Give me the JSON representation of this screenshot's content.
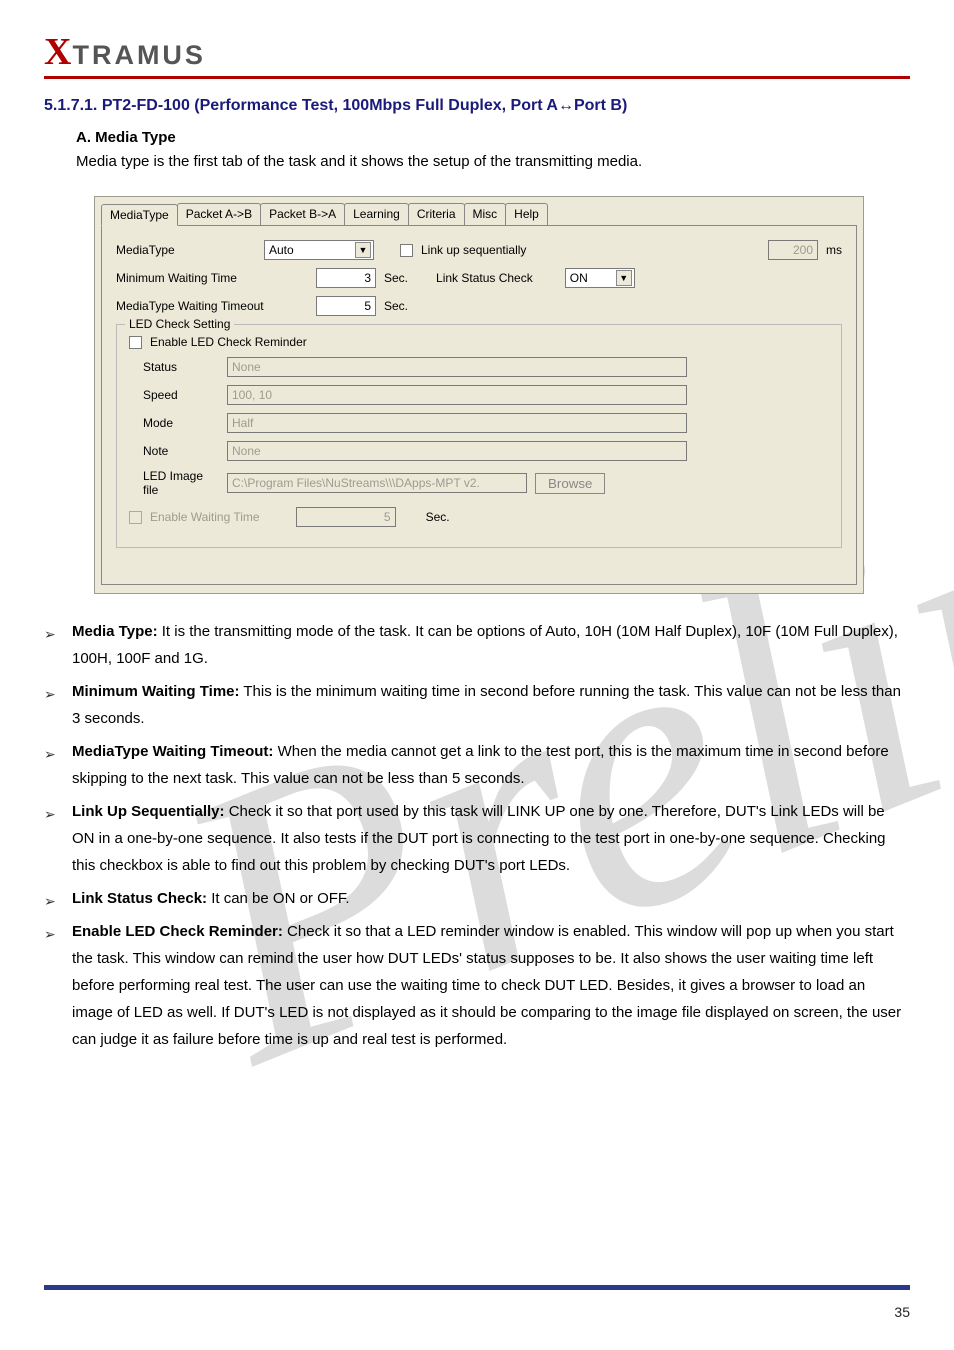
{
  "logo": {
    "x": "X",
    "text": "TRAMUS"
  },
  "heading": {
    "num": "5.1.7.1.",
    "title_prefix": "PT2-FD-100 (Performance Test, 100Mbps Full Duplex, Port A",
    "arrow": "↔",
    "title_suffix": "Port B)"
  },
  "subtitle": "A. Media Type",
  "desc": "Media type is the first tab of the task and it shows the setup of the transmitting media.",
  "tabs": [
    "MediaType",
    "Packet A->B",
    "Packet B->A",
    "Learning",
    "Criteria",
    "Misc",
    "Help"
  ],
  "form": {
    "mediaType_label": "MediaType",
    "mediaType_value": "Auto",
    "linkup_label": "Link up sequentially",
    "linkup_ms_value": "200",
    "ms": "ms",
    "minWait_label": "Minimum Waiting Time",
    "minWait_value": "3",
    "sec": "Sec.",
    "linkStatus_label": "Link Status Check",
    "linkStatus_value": "ON",
    "mtTimeout_label": "MediaType Waiting Timeout",
    "mtTimeout_value": "5",
    "led_group": "LED Check Setting",
    "enableLED_label": "Enable LED Check Reminder",
    "status_label": "Status",
    "status_value": "None",
    "speed_label": "Speed",
    "speed_value": "100, 10",
    "mode_label": "Mode",
    "mode_value": "Half",
    "note_label": "Note",
    "note_value": "None",
    "ledfile_label": "LED Image file",
    "ledfile_value": "C:\\Program Files\\NuStreams\\\\\\DApps-MPT v2.",
    "browse": "Browse",
    "enableWait_label": "Enable Waiting Time",
    "enableWait_value": "5"
  },
  "bullets": {
    "b1": {
      "label": "Media Type:",
      "text": " It is the transmitting mode of the task. It can be options of Auto, 10H (10M Half Duplex), 10F (10M Full Duplex), 100H, 100F and 1G."
    },
    "b2": {
      "label": "Minimum Waiting Time:",
      "text": " This is the minimum waiting time in second before running the task. This value can not be less than 3 seconds."
    },
    "b3": {
      "label": "MediaType Waiting Timeout:",
      "text": " When the media cannot get a link to the test port, this is the maximum time in second before skipping to the next task. This value can not be less than 5 seconds."
    },
    "b4": {
      "label": "Link Up Sequentially:",
      "text": " Check it so that port used by this task will LINK UP one by one. Therefore, DUT's Link LEDs will be ON in a one",
      "rest": "-by-one sequence. It also tests if the DUT port is connecting to the test port in one-by-one sequence. Checking this checkbox is able to find out this problem by checking DUT's port LEDs."
    },
    "b5": {
      "label": "Link Status Check:",
      "text": " It can be ON or OFF."
    },
    "b6": {
      "label": "Enable LED Check Reminder:",
      "text": " Check it so that a LED reminder window is enabled. This window will pop up when you start the task. This window can remind the user how DUT LEDs'",
      "rest2": "status supposes to be. It also shows the user waiting time left before performing real test. The user can use the waiting time to check DUT LED. Besides, it gives a browser to load an image of LED as well. If DUT's LED is not displayed as it should be comparing to the image file displayed on",
      "rest3": "screen, the user can judge it as failure before time is up and real test is performed."
    }
  },
  "pagenum": "35"
}
